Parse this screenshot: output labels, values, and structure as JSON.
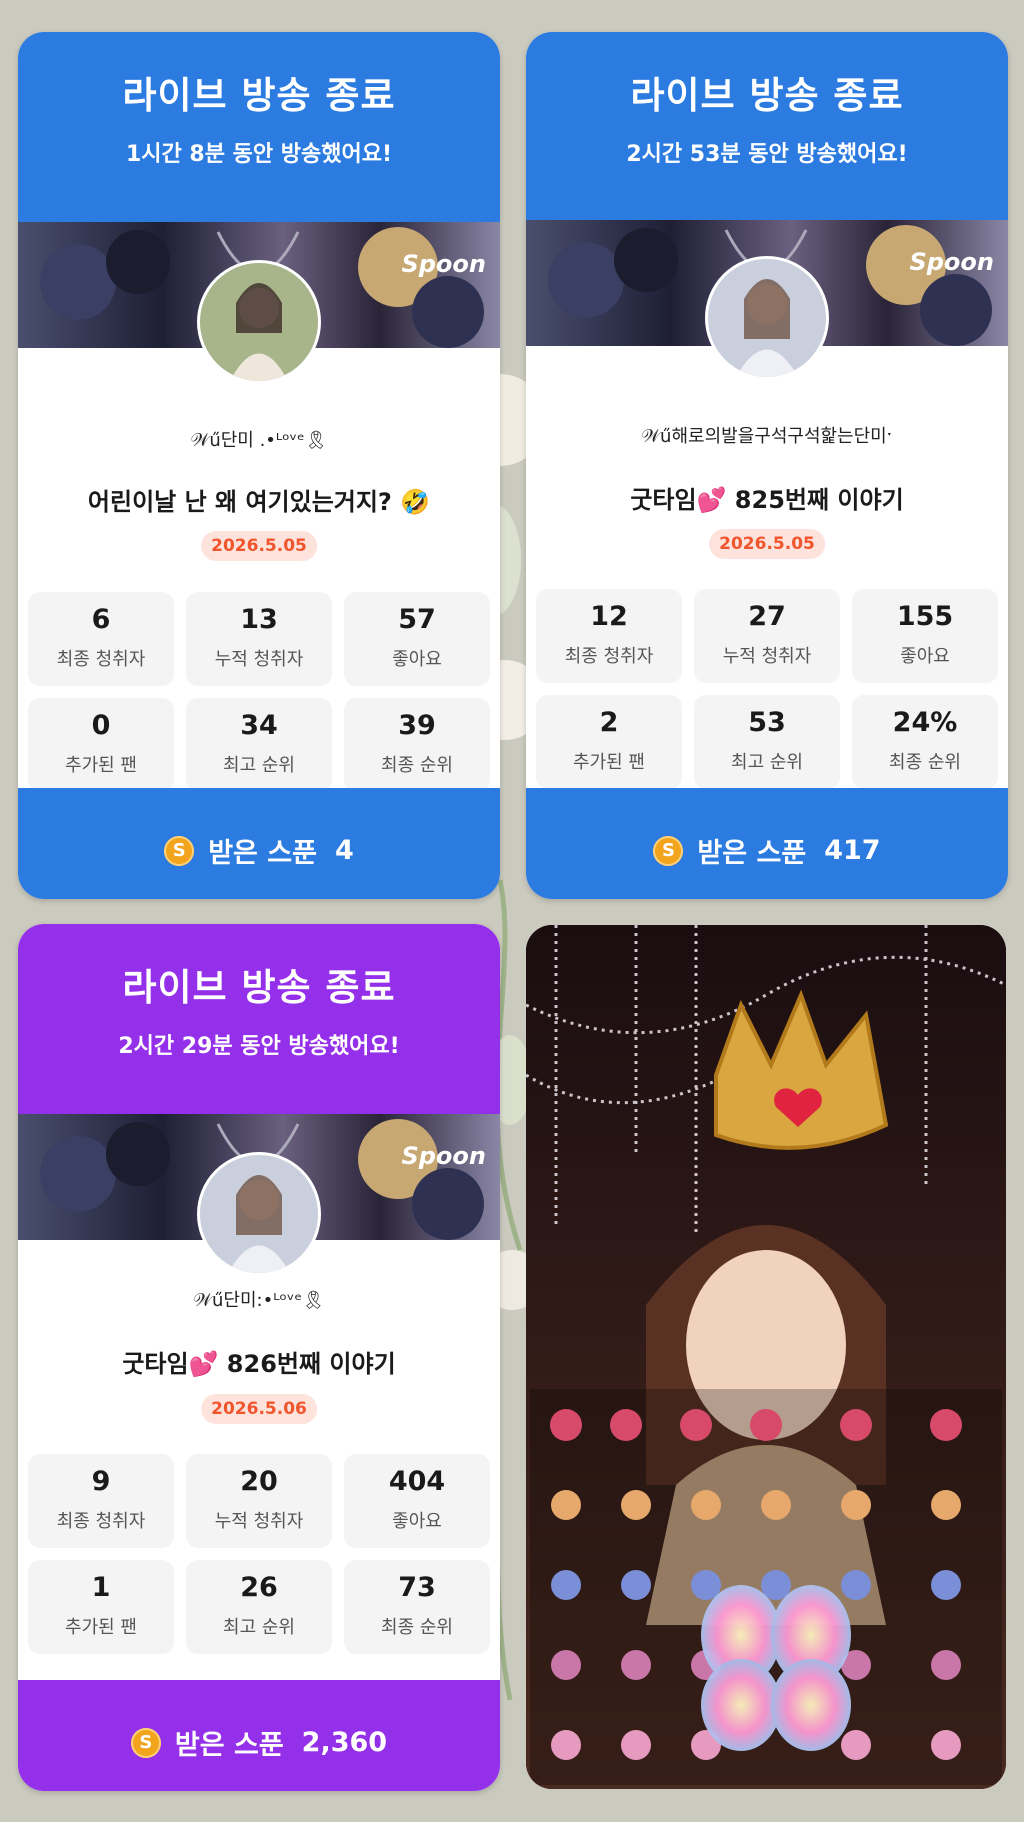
{
  "colors": {
    "blue": "#2b7be0",
    "purple": "#9530ea",
    "date_text": "#f0552d",
    "date_bg": "#fde3dc",
    "coin": "#f2a41d"
  },
  "cards": [
    {
      "title": "라이브 방송 종료",
      "subtitle": "1시간 8분 동안 방송했어요!",
      "brand": "Spoon",
      "nickname": "𝒲ű단미 .•ᴸᵒᵛᵉ🎗",
      "show_title": "어린이날 난 왜 여기있는거지? 🤣",
      "date": "2026.5.05",
      "stats": [
        {
          "value": "6",
          "label": "최종 청취자"
        },
        {
          "value": "13",
          "label": "누적 청취자"
        },
        {
          "value": "57",
          "label": "좋아요"
        },
        {
          "value": "0",
          "label": "추가된 팬"
        },
        {
          "value": "34",
          "label": "최고 순위"
        },
        {
          "value": "39",
          "label": "최종 순위"
        }
      ],
      "spoon_label": "받은 스푼",
      "spoon_value": "4",
      "coin_icon": "S"
    },
    {
      "title": "라이브 방송 종료",
      "subtitle": "2시간 53분 동안 방송했어요!",
      "brand": "Spoon",
      "nickname": "𝒲ű해로의발을구석구석핥는단미ˑ",
      "show_title": "굿타임💕 825번째 이야기",
      "date": "2026.5.05",
      "stats": [
        {
          "value": "12",
          "label": "최종 청취자"
        },
        {
          "value": "27",
          "label": "누적 청취자"
        },
        {
          "value": "155",
          "label": "좋아요"
        },
        {
          "value": "2",
          "label": "추가된 팬"
        },
        {
          "value": "53",
          "label": "최고 순위"
        },
        {
          "value": "24%",
          "label": "최종 순위"
        }
      ],
      "spoon_label": "받은 스푼",
      "spoon_value": "417",
      "coin_icon": "S"
    },
    {
      "title": "라이브 방송 종료",
      "subtitle": "2시간 29분 동안 방송했어요!",
      "brand": "Spoon",
      "nickname": "𝒲ű단미:•ᴸᵒᵛᵉ🎗",
      "show_title": "굿타임💕 826번째 이야기",
      "date": "2026.5.06",
      "stats": [
        {
          "value": "9",
          "label": "최종 청취자"
        },
        {
          "value": "20",
          "label": "누적 청취자"
        },
        {
          "value": "404",
          "label": "좋아요"
        },
        {
          "value": "1",
          "label": "추가된 팬"
        },
        {
          "value": "26",
          "label": "최고 순위"
        },
        {
          "value": "73",
          "label": "최종 순위"
        }
      ],
      "spoon_label": "받은 스푼",
      "spoon_value": "2,360",
      "coin_icon": "S"
    }
  ]
}
